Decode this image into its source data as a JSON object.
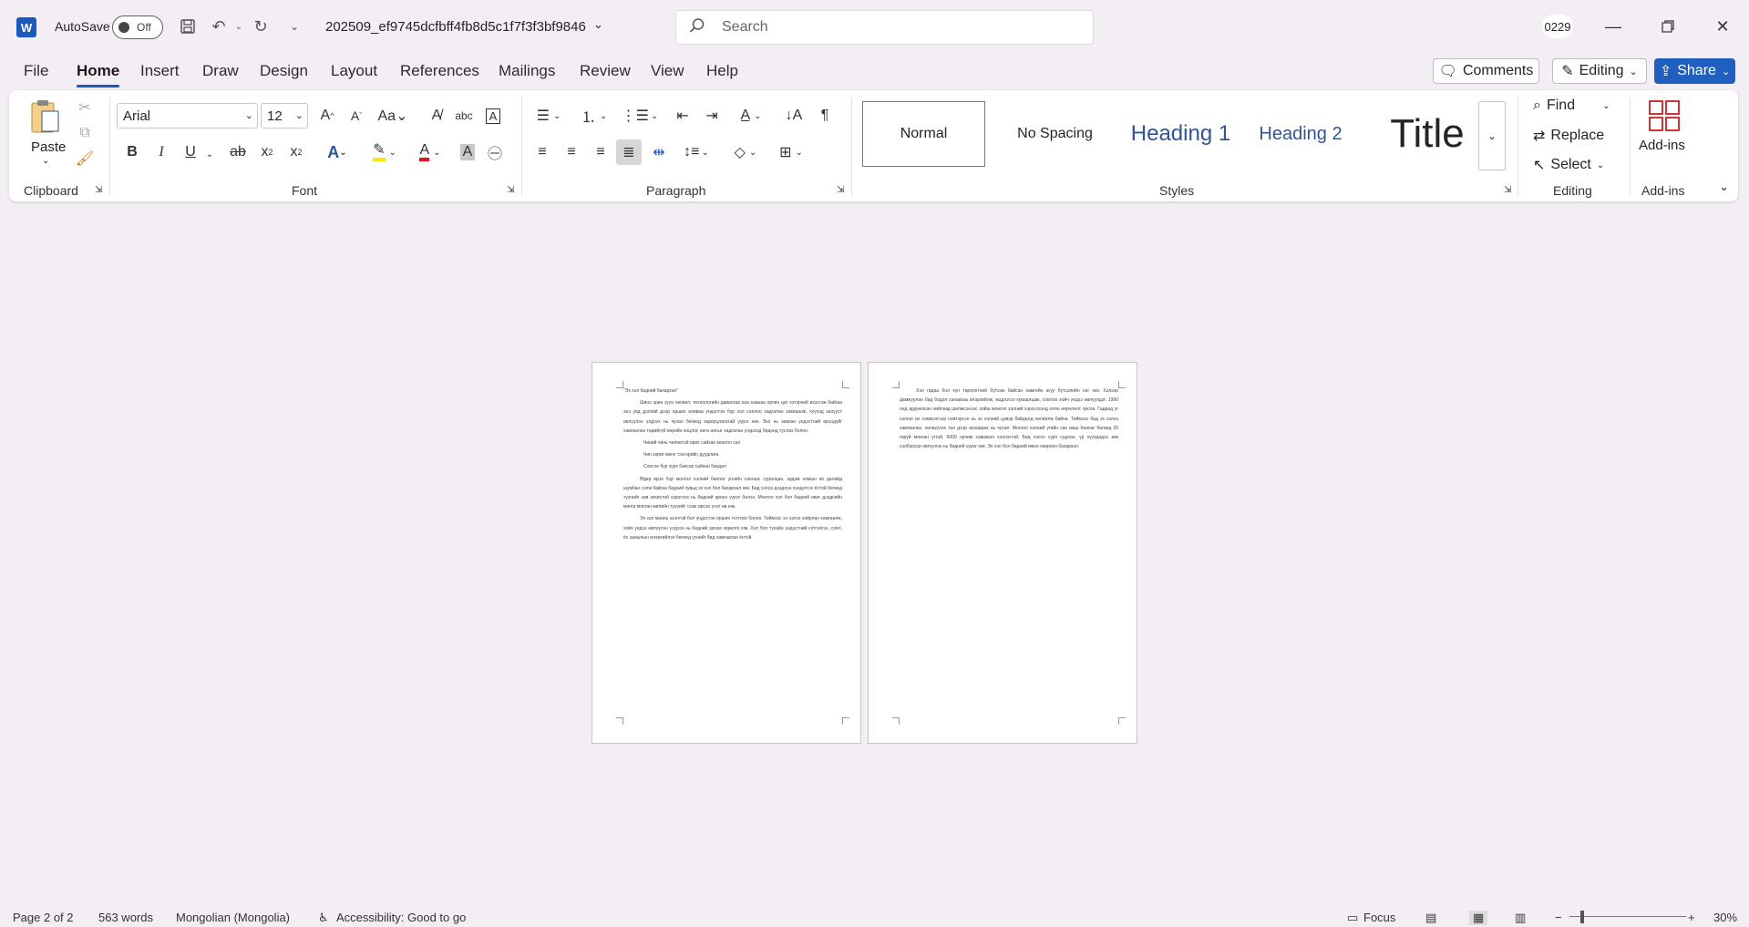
{
  "titlebar": {
    "autosave_label": "AutoSave",
    "autosave_state": "Off",
    "doc_title": "202509_ef9745dcfbff4fb8d5c1f7f3f3bf9846",
    "search_placeholder": "Search",
    "user_initials": "0229"
  },
  "menu": {
    "tabs": [
      "File",
      "Home",
      "Insert",
      "Draw",
      "Design",
      "Layout",
      "References",
      "Mailings",
      "Review",
      "View",
      "Help"
    ],
    "active_tab": "Home",
    "comments_label": "Comments",
    "editing_label": "Editing",
    "share_label": "Share"
  },
  "ribbon": {
    "clipboard": {
      "paste_label": "Paste",
      "group_label": "Clipboard"
    },
    "font": {
      "font_name": "Arial",
      "font_size": "12",
      "group_label": "Font"
    },
    "paragraph": {
      "group_label": "Paragraph"
    },
    "styles": {
      "items": [
        "Normal",
        "No Spacing",
        "Heading 1",
        "Heading 2",
        "Title"
      ],
      "group_label": "Styles"
    },
    "editing": {
      "find_label": "Find",
      "replace_label": "Replace",
      "select_label": "Select",
      "group_label": "Editing"
    },
    "addins": {
      "label": "Add-ins",
      "group_label": "Add-ins"
    },
    "colors": {
      "accent": "#185abd",
      "heading": "#2f5597",
      "font_color": "#e81123",
      "highlight": "#ffe600"
    }
  },
  "document": {
    "page1": {
      "title": "\"Эх хэл бидний бахархал\"",
      "paragraphs": [
        "Шинэ эрин зуун хөгжил, технологийн давалгаа хаа хаанаа орчин цаг хэтэрхий ихэсгэж байгаа энэ үед дэлхий дээр орших аливаа үндэстэн бүр хэл соёлоо хадгалан хамгаалж, хүүхэд залууст өвлүүлэн үлдээх нь чухал бөгөөд хариуцлагатай үүрэг юм. Энэ нь зөвхөн үндэстний ирээдүйг хамгаалах төдийгүй өөрийн онцлог, өнгө аясыг хадгалан үлдэхэд бидэнд туслах болно.",
        "Чиний чинь чөлөөтэй ярих сайхан монгол хэл",
        "Чин зориг мөнх тэнгэрийн дуудлага",
        "Сонсох бүр зүрх баясах сайхан бахдал",
        "Өдөр ирэх бүр монгол хэлний баялаг үгсийн сангаас суралцан, эрдэм номын их далайд шумбан сэлж байгаа бидний хувьд эх хэл бол бахархал юм. Бид хэлээ дээдлэн хүндэтгэх ёстой бөгөөд түүнийг зөв зохистой хэрэглэх нь бидний ариун үүрэг билээ. Монгол хэл бол бидний өвөг дээдсийн мянга мянган жилийн түүхийг тээж ирсэн үнэт өв юм.",
        "Эх хэл маань эзэнтэй бол үндэстэн оршин тогтнох болно. Тиймээс эх хэлээ хайрлан хамгаалж, хойч үедээ өвлүүлэн үлдээх нь бидний эрхэм зорилго юм. Хэл бол тухайн үндэстний сэтгэлгээ, соёл, ёс заншлын илэрхийлэл бөгөөд үүнийг бид хамгаалах ёстой."
      ]
    },
    "page2": {
      "paragraphs": [
        "Хэл гадаа бол хүн төрөлхтний бүтээж байсан хамгийн агуу бүтээлийн нэг юм. Хэлээр дамжуулан бид бодол санаагаа илэрхийлж, мэдлэгээ хуваалцаж, соёлоо хойч үедээ өвлүүлдэг. 1990 онд ардчилсан нийгэмд шилжсэнээс хойш монгол хэлний хэрэглээнд олон өөрчлөлт орсон. Гадаад үг хэллэг их хэмжээгээр нэвтэрсэн нь эх хэлний цэвэр байдалд нөлөөлж байна. Тиймээс бид эх хэлээ хамгаалах, хөгжүүлэх тал дээр анхаарах нь чухал. Монгол хэлний үгийн сан маш баялаг бөгөөд 20 гаруй мянган үгтэй, 6000 орчим хэвшмэл хэллэгтэй. Бид хэлээ сурч судлан, үр хүүхдэдээ зөв хэлбэрээр өвлүүлэх нь бидний үүрэг юм. Эх хэл бол бидний мөнх хөөрхөн бахархал."
      ]
    }
  },
  "status": {
    "page": "Page 2 of 2",
    "words": "563 words",
    "language": "Mongolian (Mongolia)",
    "accessibility": "Accessibility: Good to go",
    "focus": "Focus",
    "zoom": "30%"
  }
}
